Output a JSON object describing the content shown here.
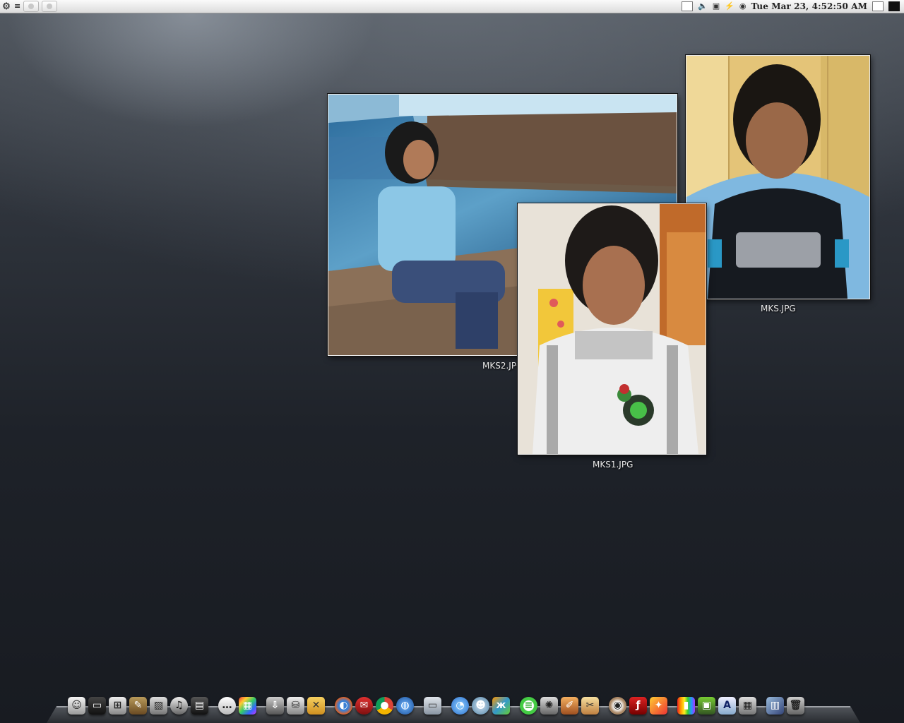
{
  "top_panel": {
    "clock": "Tue Mar 23,  4:52:50 AM",
    "tray_icons": [
      "volume-icon",
      "display-icon",
      "network-icon",
      "power-icon"
    ]
  },
  "desktop": {
    "photos": [
      {
        "label": "MKS2.JPG",
        "description_icon": "photo-thumbnail-icon"
      },
      {
        "label": "MKS.JPG",
        "description_icon": "photo-thumbnail-icon"
      },
      {
        "label": "MKS1.JPG",
        "description_icon": "photo-thumbnail-icon"
      }
    ]
  },
  "dock": {
    "items": [
      "finder-icon",
      "monitor-icon",
      "network-places-icon",
      "notes-icon",
      "pictures-icon",
      "music-icon",
      "movies-icon",
      "chat-bubble-icon",
      "color-picker-icon",
      "downloads-icon",
      "database-icon",
      "map-icon",
      "firefox-icon",
      "mail-icon",
      "chrome-icon",
      "globe-icon",
      "folder-icon",
      "im-icon",
      "pidgin-icon",
      "butterfly-icon",
      "evernote-icon",
      "film-reel-icon",
      "paint-icon",
      "inkscape-icon",
      "eye-icon",
      "flash-icon",
      "photo-editor-icon",
      "color-bars-icon",
      "terminal-icon",
      "text-editor-icon",
      "calculator-icon",
      "desktop-icon",
      "trash-icon"
    ]
  }
}
